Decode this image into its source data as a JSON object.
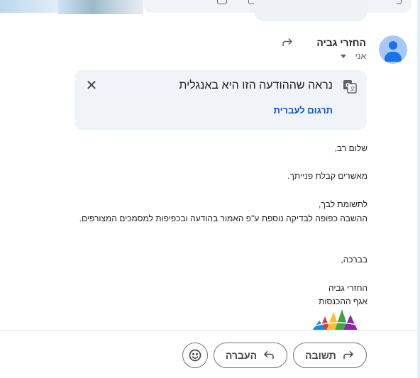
{
  "header": {
    "sender_name": "החזרי גביה",
    "recipient": "אני"
  },
  "translate_banner": {
    "title": "נראה שההודעה הזו היא באנגלית",
    "action_link": "תרגום לעברית",
    "close_symbol": "✕"
  },
  "message": {
    "lines": [
      "שלום רב,",
      "מאשרים קבלת פנייתך.",
      "לתשומת לבך,",
      "ההשבה כפופה לבדיקה נוספת ע\"פ האמור בהודעה ובכפיפות למסמכים המצורפים.",
      "בברכה,",
      "החזרי גביה",
      "אגף ההכנסות"
    ]
  },
  "actions": {
    "reply_label": "תשובה",
    "forward_label": "העברה"
  },
  "colors": {
    "accent_link": "#0b57d0",
    "avatar_bg": "#a8c7fa",
    "avatar_fg": "#1a73e8",
    "banner_bg": "#f0f4f9"
  },
  "icons": {
    "forwarded": "forward-arrow-icon",
    "translate": "translate-icon",
    "close": "close-icon",
    "reply": "reply-arrow-icon",
    "forward": "forward-arrow-icon",
    "emoji": "emoji-icon",
    "dropdown": "caret-down-icon"
  }
}
